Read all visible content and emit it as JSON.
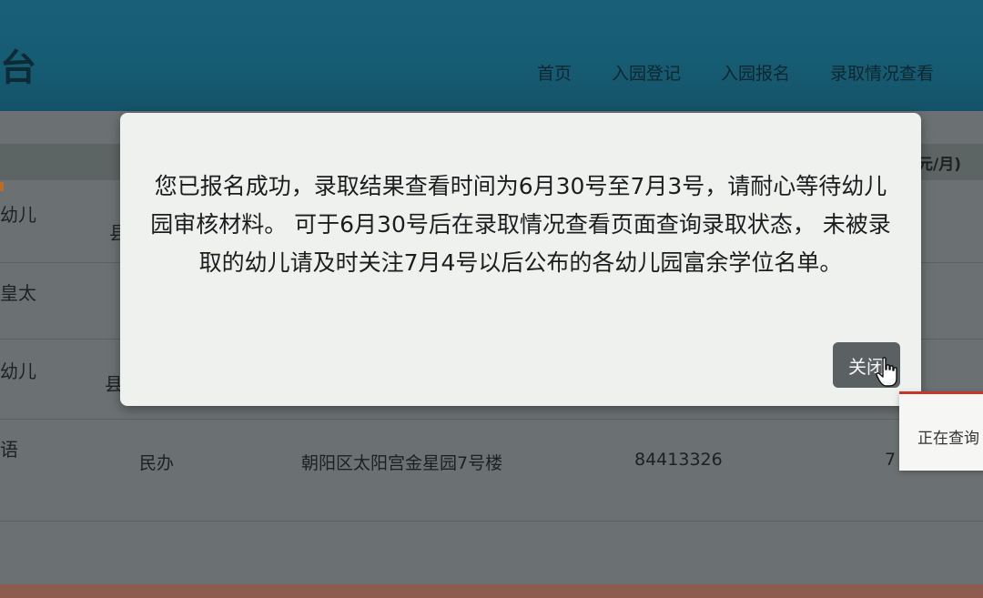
{
  "header": {
    "title_fragment": "台",
    "nav": [
      "首页",
      "入园登记",
      "入园报名",
      "录取情况查看"
    ]
  },
  "table": {
    "header_tail": "元/月)",
    "left_fragments": [
      "幼儿",
      "县",
      "皇太",
      "县",
      "幼儿",
      "语"
    ],
    "row": {
      "type": "民办",
      "address": "朝阳区太阳宫金星园7号楼",
      "phone": "84413326",
      "fee_fragment": "7"
    }
  },
  "modal": {
    "message": "您已报名成功，录取结果查看时间为6月30号至7月3号，请耐心等待幼儿园审核材料。 可于6月30号后在录取情况查看页面查询录取状态， 未被录取的幼儿请及时关注7月4号以后公布的各幼儿园富余学位名单。",
    "close_label": "关闭"
  },
  "toast": {
    "text": "正在查询"
  }
}
